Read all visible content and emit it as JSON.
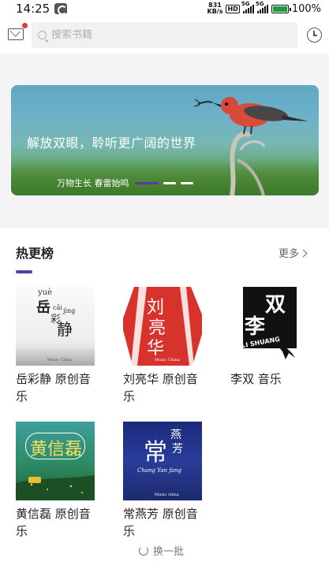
{
  "status_bar": {
    "time": "14:25",
    "net_speed_value": "831",
    "net_speed_unit": "KB/s",
    "hd_label": "HD",
    "sim1_label": "5G",
    "sim2_label": "5G",
    "battery": "100%"
  },
  "header": {
    "search_placeholder": "搜索书籍"
  },
  "banner": {
    "title": "解放双眼，聆听更广阔的世界",
    "subtitle": "万物生长  春雷始鸣",
    "slide_count": 3,
    "active_slide": 1
  },
  "hot": {
    "title": "热更榜",
    "more_label": "更多",
    "refresh_label": "换一批",
    "books": [
      {
        "name": "岳彩静 原创音乐",
        "cover_title": "岳彩静",
        "cover_pinyin_top": "yuè",
        "cover_pinyin_mid": "cǎi",
        "cover_pinyin_low": "jìng",
        "cover_footer": "Music China"
      },
      {
        "name": "刘亮华 原创音乐",
        "cover_title": "刘亮华",
        "cover_footer": "Music China"
      },
      {
        "name": "李双 音乐",
        "cover_title": "李双",
        "cover_pinyin": "LI SHUANG"
      },
      {
        "name": "黄信磊 原创音乐",
        "cover_title": "黄信磊"
      },
      {
        "name": "常燕芳 原创音乐",
        "cover_title": "常燕芳",
        "cover_pinyin": "Chang Yan fang",
        "cover_footer": "Music china"
      }
    ]
  },
  "colors": {
    "accent": "#5a3aa0",
    "notify_dot": "#e53a2f"
  }
}
